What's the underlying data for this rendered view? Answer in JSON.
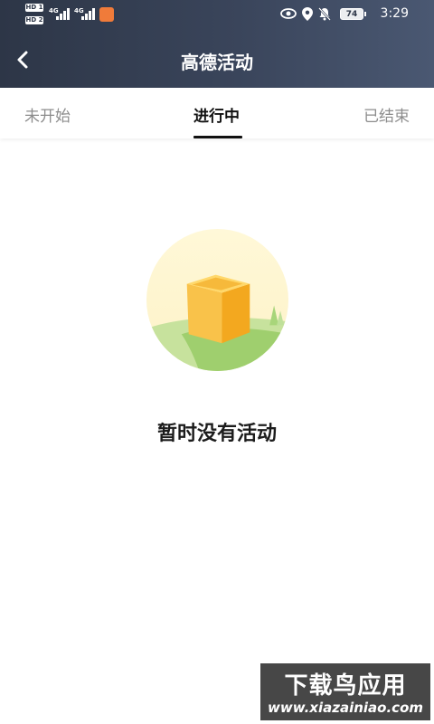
{
  "status_bar": {
    "sim1_badge": "HD 1",
    "sim2_badge": "HD 2",
    "sim1_network": "4G",
    "sim2_network": "4G",
    "battery_level": "74",
    "time": "3:29"
  },
  "header": {
    "title": "高德活动",
    "back_icon": "chevron-left-icon"
  },
  "tabs": [
    {
      "label": "未开始",
      "active": false
    },
    {
      "label": "进行中",
      "active": true
    },
    {
      "label": "已结束",
      "active": false
    }
  ],
  "empty_state": {
    "message": "暂时没有活动",
    "icon": "empty-box-illustration"
  },
  "watermark": {
    "brand": "下载鸟应用",
    "url": "www.xiazainiao.com"
  },
  "colors": {
    "header_bg": "#2d3647",
    "accent_box": "#f7b733",
    "tab_active": "#111111",
    "tab_inactive": "#8c8c8c"
  }
}
